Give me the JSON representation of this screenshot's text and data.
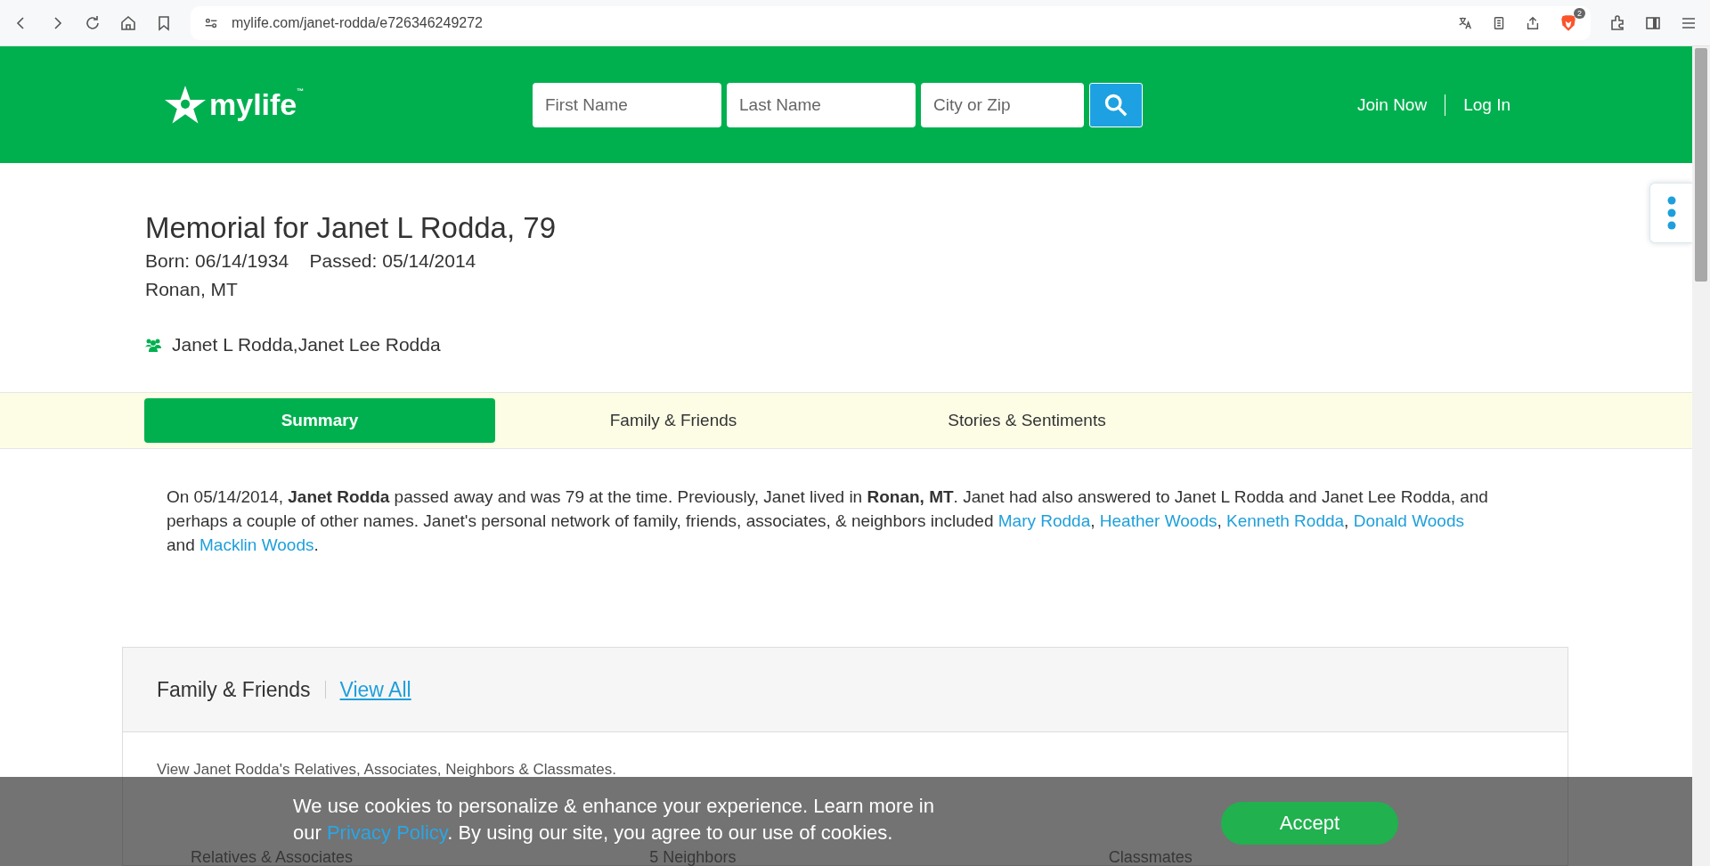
{
  "browser": {
    "url": "mylife.com/janet-rodda/e726346249272",
    "extension_badge": "2"
  },
  "header": {
    "logo": "mylife$^{™}$",
    "search_fields": [
      {
        "placeholder": "First Name"
      },
      {
        "placeholder": "Last Name"
      },
      {
        "placeholder": "City or Zip"
      }
    ],
    "nav": [
      "Join Now",
      "Log In"
    ]
  },
  "memorial": {
    "title": "Memorial for Janet L Rodda, 79",
    "born": "Born: 06/14/1934",
    "passed": "Passed: 05/14/2014",
    "location": "Ronan, MT",
    "aliases": "Janet L Rodda,Janet Lee Rodda"
  },
  "tabs": [
    {
      "label": "Summary",
      "selected": true
    },
    {
      "label": "Family & Friends",
      "selected": false
    },
    {
      "label": "Stories & Sentiments",
      "selected": false
    }
  ],
  "summary": [
    {
      "kind": "text",
      "text": "On 05/14/2014, **Janet Rodda** passed away and was 79 at the time. Previously, Janet lived in **Ronan, MT**. Janet had also answered to Janet L Rodda and Janet Lee Rodda, and perhaps a couple of other names. Janet's personal network of family, friends, associates, & neighbors included "
    },
    {
      "kind": "link",
      "text": "Mary Rodda"
    },
    {
      "kind": "text",
      "text": ", "
    },
    {
      "kind": "link",
      "text": "Heather Woods"
    },
    {
      "kind": "text",
      "text": ", "
    },
    {
      "kind": "link",
      "text": "Kenneth Rodda"
    },
    {
      "kind": "text",
      "text": ", "
    },
    {
      "kind": "link",
      "text": "Donald Woods"
    },
    {
      "kind": "text",
      "text": " and "
    },
    {
      "kind": "link",
      "text": "Macklin Woods"
    },
    {
      "kind": "text",
      "text": "."
    }
  ],
  "family_card": {
    "title": "Family & Friends",
    "view_all": "View All",
    "intro": "View Janet Rodda's Relatives, Associates, Neighbors & Classmates.",
    "columns": [
      "Relatives & Associates",
      "5 Neighbors",
      "Classmates"
    ]
  },
  "cookie_banner": {
    "segments": [
      {
        "kind": "text",
        "text": "We use cookies to personalize & enhance your experience. Learn more in our "
      },
      {
        "kind": "link",
        "text": "Privacy Policy"
      },
      {
        "kind": "text",
        "text": ". By using our site, you agree to our use of cookies."
      }
    ],
    "button": "Accept"
  }
}
